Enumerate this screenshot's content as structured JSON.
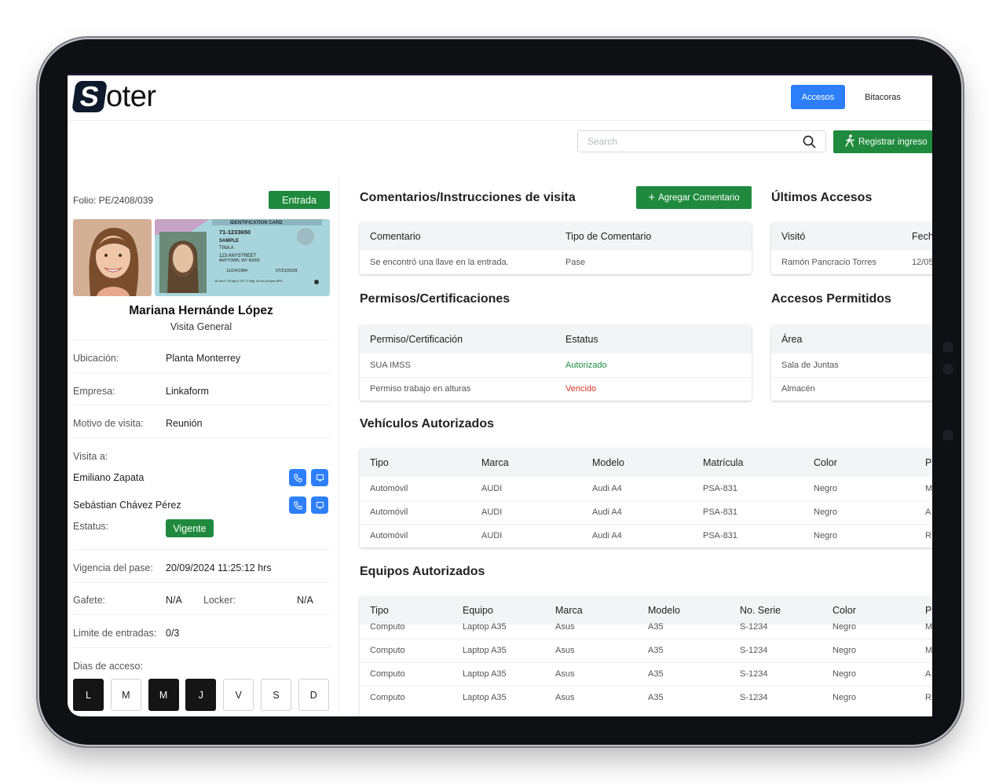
{
  "header": {
    "logo_letter": "S",
    "logo_rest": "oter",
    "nav": [
      {
        "label": "Accesos"
      },
      {
        "label": "Bitacoras"
      }
    ],
    "search_placeholder": "Search",
    "register_label": "Registrar ingreso"
  },
  "visitor": {
    "folio": "Folio: PE/2408/039",
    "status_badge": "Entrada",
    "name": "Mariana Hernánde López",
    "type": "Visita General",
    "id_card": {
      "header": "IDENTIFICATION CARD",
      "number": "71-1233650",
      "line1": "SAMPLE",
      "line2": "TINA A",
      "line3": "123 ANYSTREET",
      "line4": "ANYTOWN, WY 82000",
      "dob": "11/24/1984",
      "exp": "07/21/2028",
      "stats": "16 Sex F  18 Hgt 5'-03\"  17 Wgt 120 lb  18 Eyes BRO"
    },
    "fields": {
      "ubicacion_label": "Ubicación:",
      "ubicacion": "Planta Monterrey",
      "empresa_label": "Empresa:",
      "empresa": "Linkaform",
      "motivo_label": "Motivo de visita:",
      "motivo": "Reunión",
      "visita_label": "Visita a:",
      "hosts": [
        "Emiliano Zapata",
        "Sebástian Chávez Pérez"
      ],
      "estatus_label": "Estatus:",
      "estatus": "Vigente",
      "vigencia_label": "Vigencia del pase:",
      "vigencia": "20/09/2024 11:25:12 hrs",
      "gafete_label": "Gafete:",
      "gafete": "N/A",
      "locker_label": "Locker:",
      "locker": "N/A",
      "limite_label": "Limite de entradas:",
      "limite": "0/3",
      "dias_label": "Dias de acceso:"
    },
    "days": [
      {
        "label": "L",
        "active": true
      },
      {
        "label": "M",
        "active": false
      },
      {
        "label": "M",
        "active": true
      },
      {
        "label": "J",
        "active": true
      },
      {
        "label": "V",
        "active": false
      },
      {
        "label": "S",
        "active": false
      },
      {
        "label": "D",
        "active": false
      }
    ]
  },
  "comentarios": {
    "title": "Comentarios/Instrucciones de visita",
    "add_label": "Agregar Comentario",
    "columns": [
      "Comentario",
      "Tipo de Comentario"
    ],
    "rows": [
      [
        "Se encontró una llave en la entrada.",
        "Pase"
      ]
    ]
  },
  "ultimos": {
    "title": "Últimos Accesos",
    "columns": [
      "Visitó",
      "Fech"
    ],
    "rows": [
      [
        "Ramón Pancracio Torres",
        "12/05"
      ]
    ]
  },
  "permisos": {
    "title": "Permisos/Certificaciones",
    "columns": [
      "Permiso/Certificación",
      "Estatus"
    ],
    "rows": [
      [
        "SUA IMSS",
        "Autorizado"
      ],
      [
        "Permiso trabajo en alturas",
        "Vencido"
      ]
    ]
  },
  "accesos_permitidos": {
    "title": "Accesos Permitidos",
    "columns": [
      "Área"
    ],
    "rows": [
      [
        "Sala de Juntas"
      ],
      [
        "Almacén"
      ]
    ]
  },
  "vehiculos": {
    "title": "Vehículos Autorizados",
    "columns": [
      "Tipo",
      "Marca",
      "Modelo",
      "Matrícula",
      "Color",
      "P"
    ],
    "rows": [
      [
        "Automóvil",
        "AUDI",
        "Audi A4",
        "PSA-831",
        "Negro",
        "M"
      ],
      [
        "Automóvil",
        "AUDI",
        "Audi A4",
        "PSA-831",
        "Negro",
        "A"
      ],
      [
        "Automóvil",
        "AUDI",
        "Audi A4",
        "PSA-831",
        "Negro",
        "R"
      ]
    ]
  },
  "equipos": {
    "title": "Equipos Autorizados",
    "columns": [
      "Tipo",
      "Equipo",
      "Marca",
      "Modelo",
      "No. Serie",
      "Color",
      "P"
    ],
    "rows": [
      [
        "Computo",
        "Laptop A35",
        "Asus",
        "A35",
        "S-1234",
        "Negro",
        "M"
      ],
      [
        "Computo",
        "Laptop A35",
        "Asus",
        "A35",
        "S-1234",
        "Negro",
        "M"
      ],
      [
        "Computo",
        "Laptop A35",
        "Asus",
        "A35",
        "S-1234",
        "Negro",
        "A"
      ],
      [
        "Computo",
        "Laptop A35",
        "Asus",
        "A35",
        "S-1234",
        "Negro",
        "R"
      ]
    ]
  },
  "colors": {
    "green": "#1f8a3d",
    "blue": "#2d7ff9",
    "red": "#d9362b"
  }
}
